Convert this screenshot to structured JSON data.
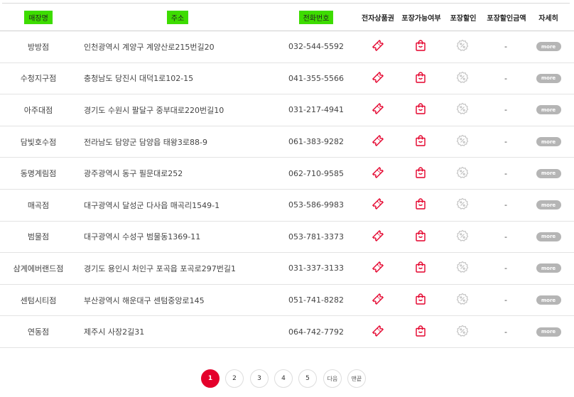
{
  "header": {
    "col_name": "매장명",
    "col_address": "주소",
    "col_phone": "전화번호",
    "col_egift": "전자상품권",
    "col_takeout": "포장가능여부",
    "col_takeout_discount": "포장할인",
    "col_takeout_discount_amount": "포장할인금액",
    "col_detail": "자세히"
  },
  "rows": [
    {
      "name": "방방점",
      "address": "인천광역시 계양구 계양산로215번길20",
      "phone": "032-544-5592",
      "amount": "-",
      "more": "more"
    },
    {
      "name": "수청지구점",
      "address": "충청남도 당진시 대덕1로102-15",
      "phone": "041-355-5566",
      "amount": "-",
      "more": "more"
    },
    {
      "name": "아주대점",
      "address": "경기도 수원시 팔달구 중부대로220번길10",
      "phone": "031-217-4941",
      "amount": "-",
      "more": "more"
    },
    {
      "name": "담빛호수점",
      "address": "전라남도 담양군 담양읍 태왕3로88-9",
      "phone": "061-383-9282",
      "amount": "-",
      "more": "more"
    },
    {
      "name": "동명계림점",
      "address": "광주광역시 동구 필문대로252",
      "phone": "062-710-9585",
      "amount": "-",
      "more": "more"
    },
    {
      "name": "매곡점",
      "address": "대구광역시 달성군 다사읍 매곡리1549-1",
      "phone": "053-586-9983",
      "amount": "-",
      "more": "more"
    },
    {
      "name": "범물점",
      "address": "대구광역시 수성구 범물동1369-11",
      "phone": "053-781-3373",
      "amount": "-",
      "more": "more"
    },
    {
      "name": "삼계에버랜드점",
      "address": "경기도 용인시 처인구 포곡읍 포곡로297번길1",
      "phone": "031-337-3133",
      "amount": "-",
      "more": "more"
    },
    {
      "name": "센텀시티점",
      "address": "부산광역시 해운대구 센텀중앙로145",
      "phone": "051-741-8282",
      "amount": "-",
      "more": "more"
    },
    {
      "name": "연동점",
      "address": "제주시 사장2길31",
      "phone": "064-742-7792",
      "amount": "-",
      "more": "more"
    }
  ],
  "pagination": {
    "pages": [
      "1",
      "2",
      "3",
      "4",
      "5"
    ],
    "current": "1",
    "next_label": "다음",
    "last_label": "맨끝"
  },
  "icons": {
    "egift": "ticket-icon",
    "takeout": "shopping-bag-icon",
    "discount": "percent-badge-icon"
  },
  "colors": {
    "accent": "#e4002b",
    "header_highlight": "#3ddc00",
    "disabled_icon": "#c4c4c4",
    "more_button": "#b5b5b5"
  }
}
